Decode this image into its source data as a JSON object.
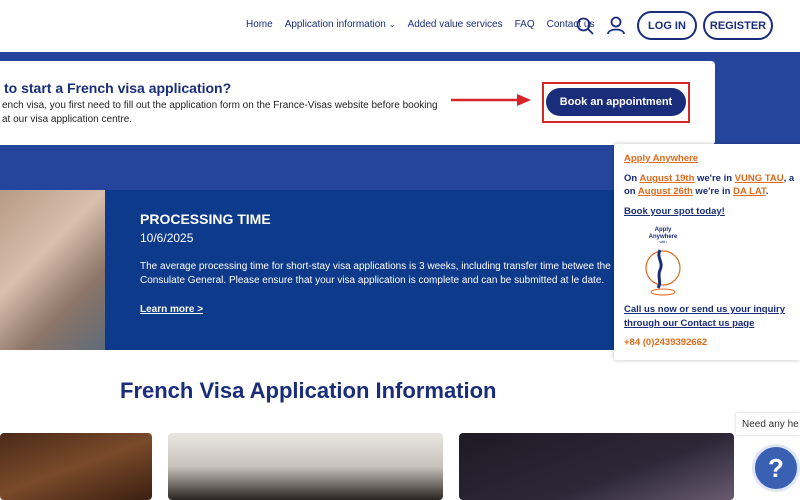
{
  "nav": {
    "home": "Home",
    "application_info": "Application information",
    "added_value": "Added value services",
    "faq": "FAQ",
    "contact": "Contact us",
    "login": "LOG IN",
    "register": "REGISTER"
  },
  "banner": {
    "title": "to start a French visa application?",
    "line1": "ench visa, you first need to fill out the application form on the France-Visas website before booking",
    "line2": "at our visa application centre.",
    "book_button": "Book an appointment"
  },
  "processing": {
    "title": "PROCESSING TIME",
    "date": "10/6/2025",
    "text": "The average processing time for short-stay visa applications is 3 weeks, including transfer time betwee the Consulate General. Please ensure that your visa application is complete and can be submitted at le date.",
    "link": "Learn more >"
  },
  "sidebar": {
    "apply_anywhere": "Apply Anywhere",
    "line1_prefix": "On ",
    "line1_date": "August 19th",
    "line1_mid": " we're in ",
    "line1_place": "VUNG TAU",
    "line1_tail": ", a",
    "line2_prefix": "on ",
    "line2_date": "August 26th",
    "line2_mid": " we're in ",
    "line2_place": "DA LAT",
    "line2_tail": ".",
    "book_spot": "Book your spot today!",
    "logo_line1": "Apply",
    "logo_line2": "Anywhere",
    "logo_line3": "with",
    "call_line1": "Call us now or send us your inquiry",
    "call_line2": "through our Contact us page",
    "phone": "+84 (0)2439392662"
  },
  "section_heading": "French Visa Application Information",
  "help": {
    "text": "Need any he",
    "icon": "?"
  },
  "colors": {
    "navy": "#1a2d7a",
    "band": "#25459c",
    "processing": "#0e3a8c",
    "orange": "#e06a1a",
    "highlight": "#d6262a"
  }
}
